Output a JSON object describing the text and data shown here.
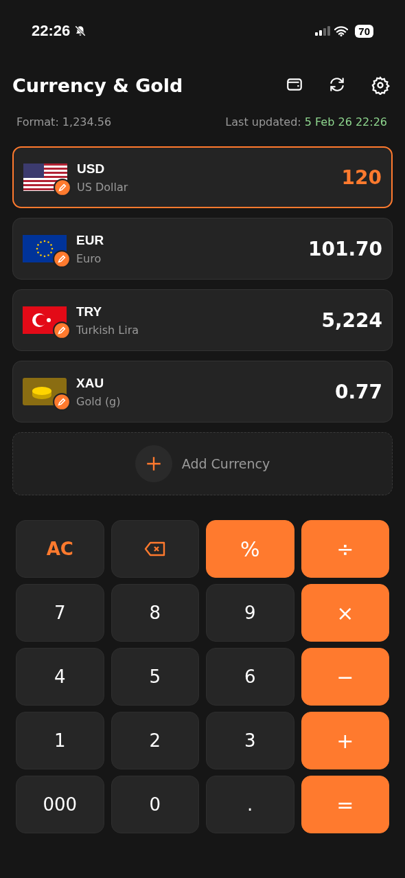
{
  "status_bar": {
    "time": "22:26",
    "battery": "70"
  },
  "header": {
    "title": "Currency & Gold"
  },
  "info": {
    "format": "Format: 1,234.56",
    "updated_label": "Last updated: ",
    "updated_value": "5 Feb 26 22:26"
  },
  "currencies": [
    {
      "code": "USD",
      "name": "US Dollar",
      "amount": "120",
      "kind": "us",
      "selected": true
    },
    {
      "code": "EUR",
      "name": "Euro",
      "amount": "101.70",
      "kind": "eu",
      "selected": false
    },
    {
      "code": "TRY",
      "name": "Turkish Lira",
      "amount": "5,224",
      "kind": "tr",
      "selected": false
    },
    {
      "code": "XAU",
      "name": "Gold (g)",
      "amount": "0.77",
      "kind": "gold",
      "selected": false
    }
  ],
  "add_button": {
    "label": "Add Currency"
  },
  "keypad": [
    {
      "kind": "function",
      "label": "AC"
    },
    {
      "kind": "backspace"
    },
    {
      "kind": "operator",
      "label": "%"
    },
    {
      "kind": "operator",
      "label": "÷"
    },
    {
      "kind": "digit",
      "label": "7"
    },
    {
      "kind": "digit",
      "label": "8"
    },
    {
      "kind": "digit",
      "label": "9"
    },
    {
      "kind": "operator",
      "label": "×"
    },
    {
      "kind": "digit",
      "label": "4"
    },
    {
      "kind": "digit",
      "label": "5"
    },
    {
      "kind": "digit",
      "label": "6"
    },
    {
      "kind": "operator",
      "label": "−"
    },
    {
      "kind": "digit",
      "label": "1"
    },
    {
      "kind": "digit",
      "label": "2"
    },
    {
      "kind": "digit",
      "label": "3"
    },
    {
      "kind": "operator",
      "label": "+"
    },
    {
      "kind": "digit",
      "label": "000"
    },
    {
      "kind": "digit",
      "label": "0"
    },
    {
      "kind": "digit",
      "label": "."
    },
    {
      "kind": "operator",
      "label": "="
    }
  ]
}
